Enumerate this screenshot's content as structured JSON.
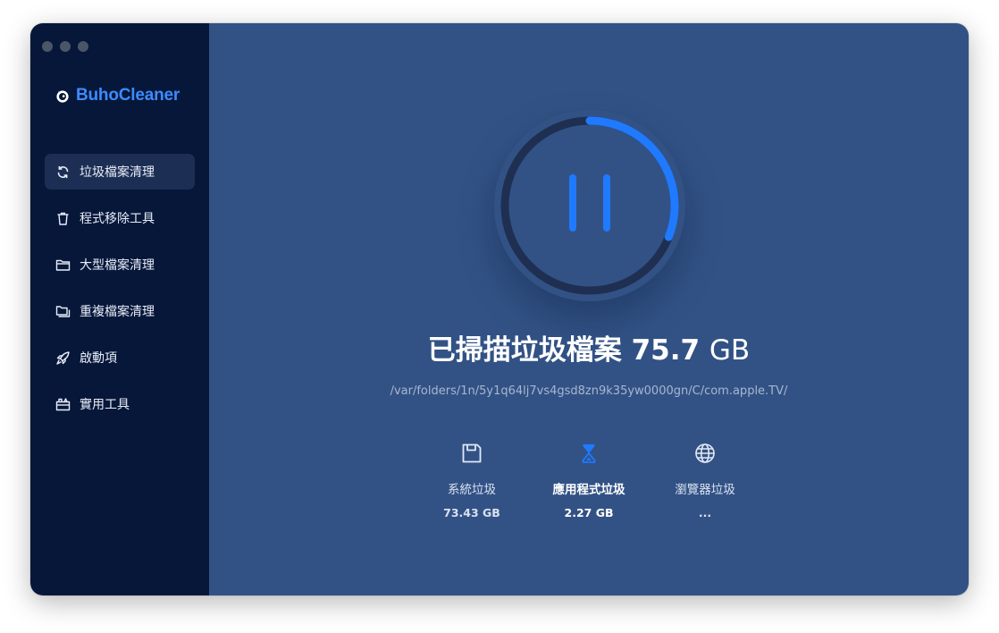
{
  "app": {
    "brand_name": "BuhoCleaner",
    "brand_color": "#3d8bff"
  },
  "sidebar": {
    "items": [
      {
        "label": "垃圾檔案清理",
        "icon": "refresh-icon",
        "active": true
      },
      {
        "label": "程式移除工具",
        "icon": "trash-icon",
        "active": false
      },
      {
        "label": "大型檔案清理",
        "icon": "folder-icon",
        "active": false
      },
      {
        "label": "重複檔案清理",
        "icon": "duplicate-folder-icon",
        "active": false
      },
      {
        "label": "啟動項",
        "icon": "rocket-icon",
        "active": false
      },
      {
        "label": "實用工具",
        "icon": "toolbox-icon",
        "active": false
      }
    ]
  },
  "scan": {
    "title": "已掃描垃圾檔案",
    "amount": "75.7",
    "unit": "GB",
    "current_path": "/var/folders/1n/5y1q64lj7vs4gsd8zn9k35yw0000gn/C/com.apple.TV/",
    "progress_fraction": 0.31,
    "accent_color": "#1f7aff"
  },
  "categories": [
    {
      "label": "系統垃圾",
      "size": "73.43 GB",
      "icon": "disk-icon",
      "active": false
    },
    {
      "label": "應用程式垃圾",
      "size": "2.27 GB",
      "icon": "hourglass-icon",
      "active": true
    },
    {
      "label": "瀏覽器垃圾",
      "size": "...",
      "icon": "globe-icon",
      "active": false
    }
  ]
}
